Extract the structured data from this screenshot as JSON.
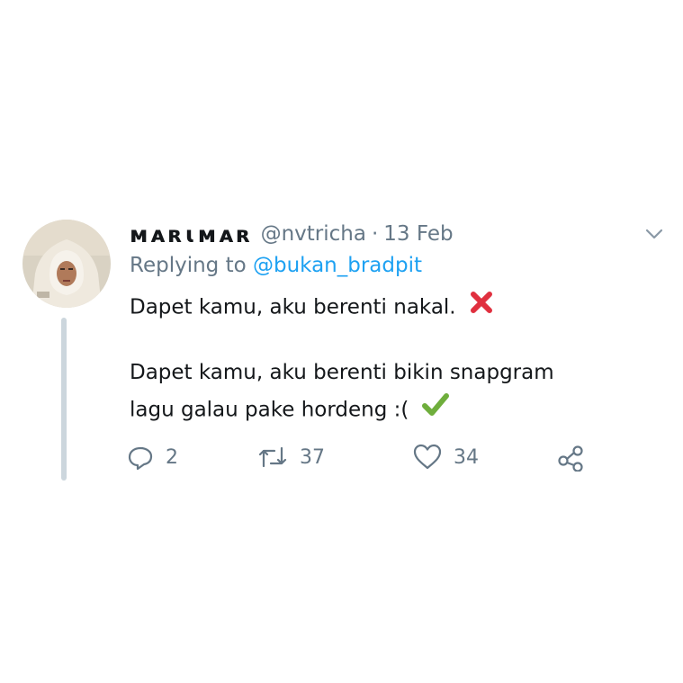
{
  "tweet": {
    "display_name": "ᴍᴀʀɩᴍᴀʀ",
    "handle": "@nvtricha",
    "separator": "·",
    "date": "13 Feb",
    "replying_prefix": "Replying to",
    "replying_to": "@bukan_bradpit",
    "line1": "Dapet kamu, aku berenti nakal.",
    "line2": "Dapet kamu, aku berenti bikin snapgram",
    "line3": "lagu galau pake hordeng :(",
    "emoji1": "cross-mark",
    "emoji2": "check-mark"
  },
  "actions": {
    "reply_count": "2",
    "retweet_count": "37",
    "like_count": "34"
  },
  "colors": {
    "text": "#14171a",
    "muted": "#657786",
    "link": "#1da1f2",
    "thread_line": "#ccd6dd",
    "cross": "#e0303f",
    "check": "#6fae3c"
  }
}
